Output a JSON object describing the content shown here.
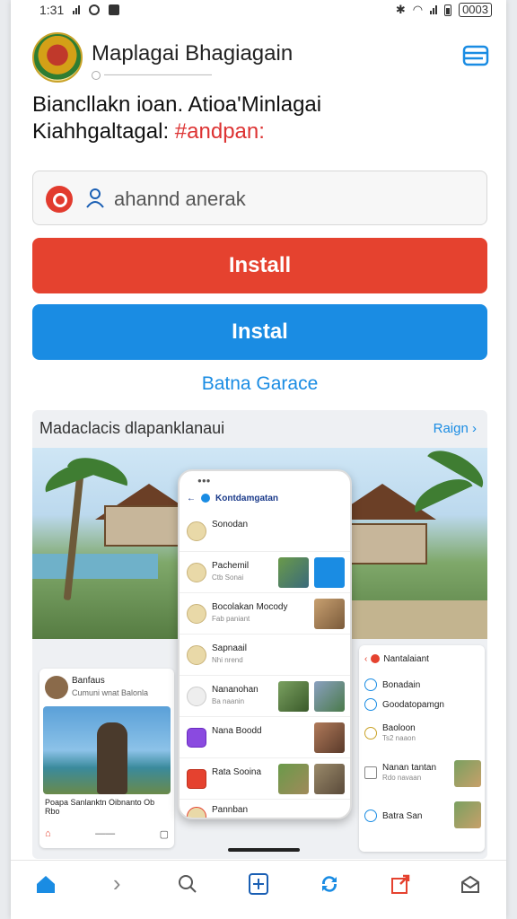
{
  "status": {
    "time": "1:31",
    "battery": "0003"
  },
  "app": {
    "name": "Maplagai Bhagiagain"
  },
  "description": {
    "line1": "Biancllakn ioan. Atioa'Minlagai",
    "line2_plain": "Kiahhgaltagal:",
    "line2_red": "#andpan:"
  },
  "search": {
    "value": "ahannd anerak"
  },
  "buttons": {
    "install_red": "Install",
    "install_blue": "Instal",
    "link": "Batna Garace"
  },
  "gallery": {
    "title": "Madaclacis dlapanklanaui",
    "more": "Raign",
    "phone_header": "Kontdamgatan",
    "phone_rows": [
      {
        "name": "Sonodan",
        "sub": ""
      },
      {
        "name": "Pachemil",
        "sub": "Ctb Sonai"
      },
      {
        "name": "Bocolakan Mocody",
        "sub": "Fab paniant"
      },
      {
        "name": "Sapnaail",
        "sub": "Nhi nrend"
      },
      {
        "name": "Nananohan",
        "sub": "Ba naanin"
      },
      {
        "name": "Nana Boodd",
        "sub": ""
      },
      {
        "name": "Rata Sooina",
        "sub": ""
      },
      {
        "name": "Pannban",
        "sub": ""
      }
    ],
    "left_card": {
      "name": "Banfaus",
      "sub": "Cumuni wnat Balonla",
      "caption": "Poapa Sanlanktn Oibnanto Ob Rbo"
    },
    "right_card": {
      "header": "Nantalaiant",
      "rows": [
        "Bonadain",
        "Goodatopamgn",
        "Baoloon",
        "Nanan tantan",
        "Batra San"
      ],
      "subs": [
        "",
        "",
        "Ts2 naaon",
        "Rdo navaan",
        ""
      ]
    }
  },
  "colors": {
    "red": "#e5422f",
    "blue": "#1a8ce3"
  }
}
